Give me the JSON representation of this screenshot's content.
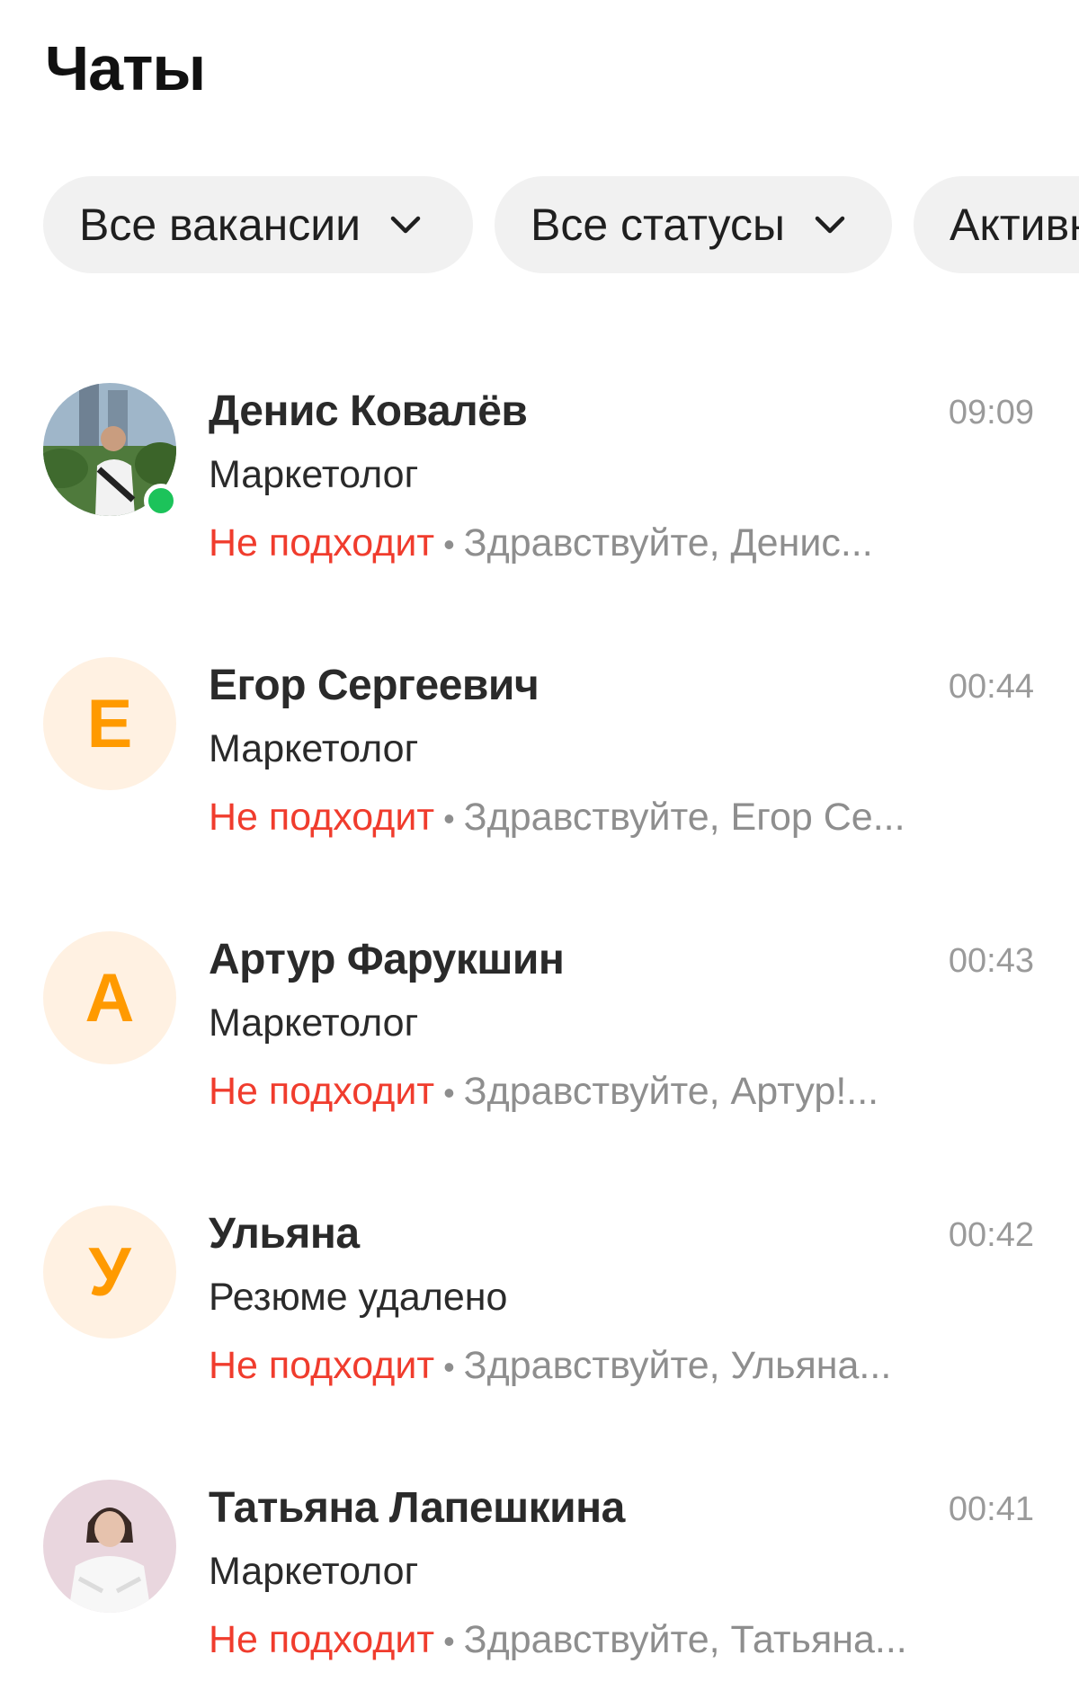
{
  "header": {
    "title": "Чаты"
  },
  "filters": [
    {
      "label": "Все вакансии",
      "icon": "chevron-down-icon"
    },
    {
      "label": "Все статусы",
      "icon": "chevron-down-icon"
    },
    {
      "label": "Активн"
    }
  ],
  "colors": {
    "status_red": "#f03c2d",
    "avatar_letter": "#ff9a00",
    "avatar_bg": "#fff1e2",
    "online": "#1cc35a"
  },
  "chats": [
    {
      "name": "Денис Ковалёв",
      "time": "09:09",
      "position": "Маркетолог",
      "status": "Не подходит",
      "separator": "•",
      "preview": "Здравствуйте, Денис...",
      "avatar": "photo",
      "online": true
    },
    {
      "name": "Егор Сергеевич",
      "time": "00:44",
      "position": "Маркетолог",
      "status": "Не подходит",
      "separator": "•",
      "preview": "Здравствуйте, Егор Се...",
      "avatar_letter": "Е"
    },
    {
      "name": "Артур Фарукшин",
      "time": "00:43",
      "position": "Маркетолог",
      "status": "Не подходит",
      "separator": "•",
      "preview": "Здравствуйте, Артур!...",
      "avatar_letter": "А"
    },
    {
      "name": "Ульяна",
      "time": "00:42",
      "position": "Резюме удалено",
      "status": "Не подходит",
      "separator": "•",
      "preview": "Здравствуйте, Ульяна...",
      "avatar_letter": "У"
    },
    {
      "name": "Татьяна Лапешкина",
      "time": "00:41",
      "position": "Маркетолог",
      "status": "Не подходит",
      "separator": "•",
      "preview": "Здравствуйте, Татьяна...",
      "avatar": "photo"
    }
  ]
}
